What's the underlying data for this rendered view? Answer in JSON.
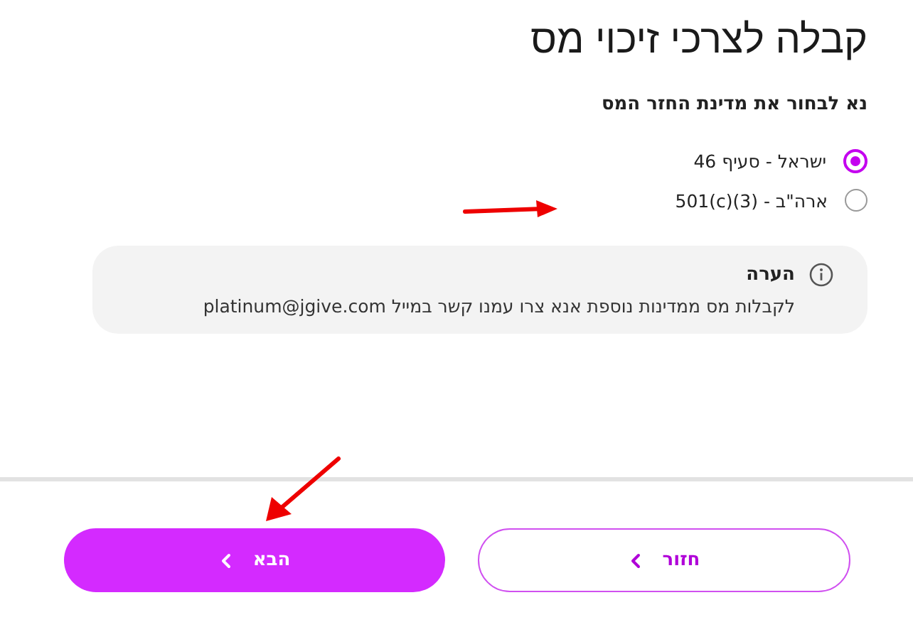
{
  "title": "קבלה לצרכי זיכוי מס",
  "question": "נא לבחור את מדינת החזר המס",
  "options": [
    {
      "label": "ישראל -",
      "section": "סעיף 46",
      "selected": true
    },
    {
      "label": "ארה\"ב -",
      "section": "501(c)(3)",
      "selected": false
    }
  ],
  "note": {
    "title": "הערה",
    "text": "לקבלות מס ממדינות נוספת אנא צרו עמנו קשר במייל platinum@jgive.com"
  },
  "buttons": [
    {
      "label": "חזור",
      "kind": "secondary"
    },
    {
      "label": "הבא",
      "kind": "primary"
    }
  ]
}
